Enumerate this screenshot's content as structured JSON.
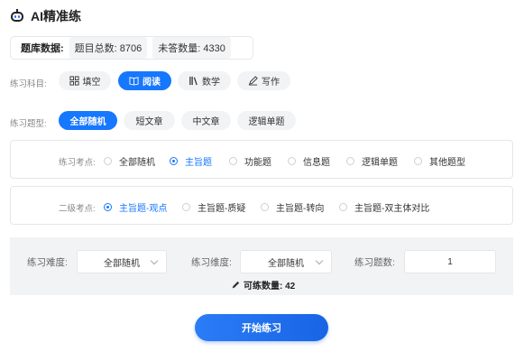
{
  "app": {
    "title": "AI精准练"
  },
  "stats": {
    "label": "题库数据:",
    "total": "题目总数: 8706",
    "unanswered": "未答数量: 4330"
  },
  "subject": {
    "label": "练习科目:",
    "options": [
      {
        "label": "填空",
        "icon": "grid-icon",
        "active": false
      },
      {
        "label": "阅读",
        "icon": "book-icon",
        "active": true
      },
      {
        "label": "数学",
        "icon": "library-icon",
        "active": false
      },
      {
        "label": "写作",
        "icon": "pen-icon",
        "active": false
      }
    ]
  },
  "question_type": {
    "label": "练习题型:",
    "options": [
      "全部随机",
      "短文章",
      "中文章",
      "逻辑单题"
    ],
    "selected": "全部随机"
  },
  "exam_point": {
    "label": "练习考点:",
    "options": [
      "全部随机",
      "主旨题",
      "功能题",
      "信息题",
      "逻辑单题",
      "其他题型"
    ],
    "selected": "主旨题"
  },
  "sub_point": {
    "label": "二级考点:",
    "options": [
      "主旨题-观点",
      "主旨题-质疑",
      "主旨题-转向",
      "主旨题-双主体对比"
    ],
    "selected": "主旨题-观点"
  },
  "settings": {
    "difficulty": {
      "label": "练习难度:",
      "value": "全部随机"
    },
    "dimension": {
      "label": "练习维度:",
      "value": "全部随机"
    },
    "count": {
      "label": "练习题数:",
      "value": "1"
    },
    "available": "可练数量: 42"
  },
  "start_button": "开始练习",
  "colors": {
    "accent": "#1677ff",
    "pill_bg": "#f2f3f5",
    "panel_bg": "#f2f3f5"
  }
}
